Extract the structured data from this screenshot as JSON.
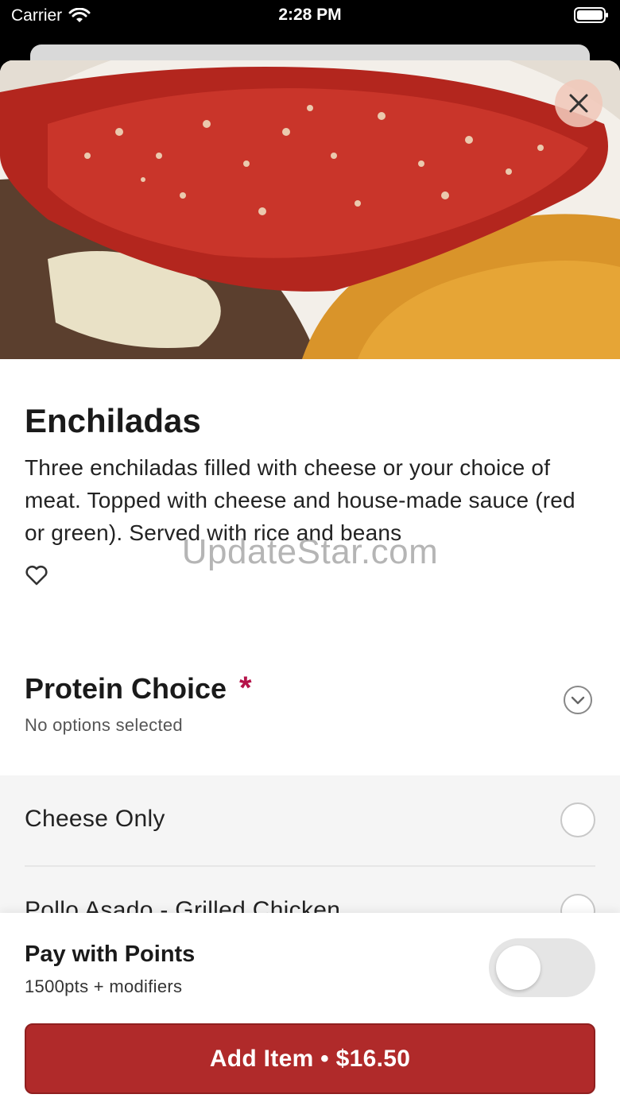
{
  "status_bar": {
    "carrier": "Carrier",
    "time": "2:28 PM"
  },
  "item": {
    "title": "Enchiladas",
    "description": "Three enchiladas filled with cheese or your choice of meat. Topped with cheese and house-made sauce (red or green). Served with rice and beans",
    "image_icon": "enchiladas-photo"
  },
  "watermark": "UpdateStar.com",
  "modifier_group": {
    "title": "Protein Choice",
    "required_mark": "*",
    "status": "No options selected",
    "options": [
      {
        "label": "Cheese Only"
      },
      {
        "label": "Pollo Asado - Grilled Chicken"
      }
    ]
  },
  "footer": {
    "points_title": "Pay with Points",
    "points_subtitle": "1500pts + modifiers",
    "points_toggle_on": false,
    "add_button_label": "Add Item • $16.50"
  },
  "colors": {
    "accent": "#b02a2a",
    "required": "#b5134a"
  }
}
